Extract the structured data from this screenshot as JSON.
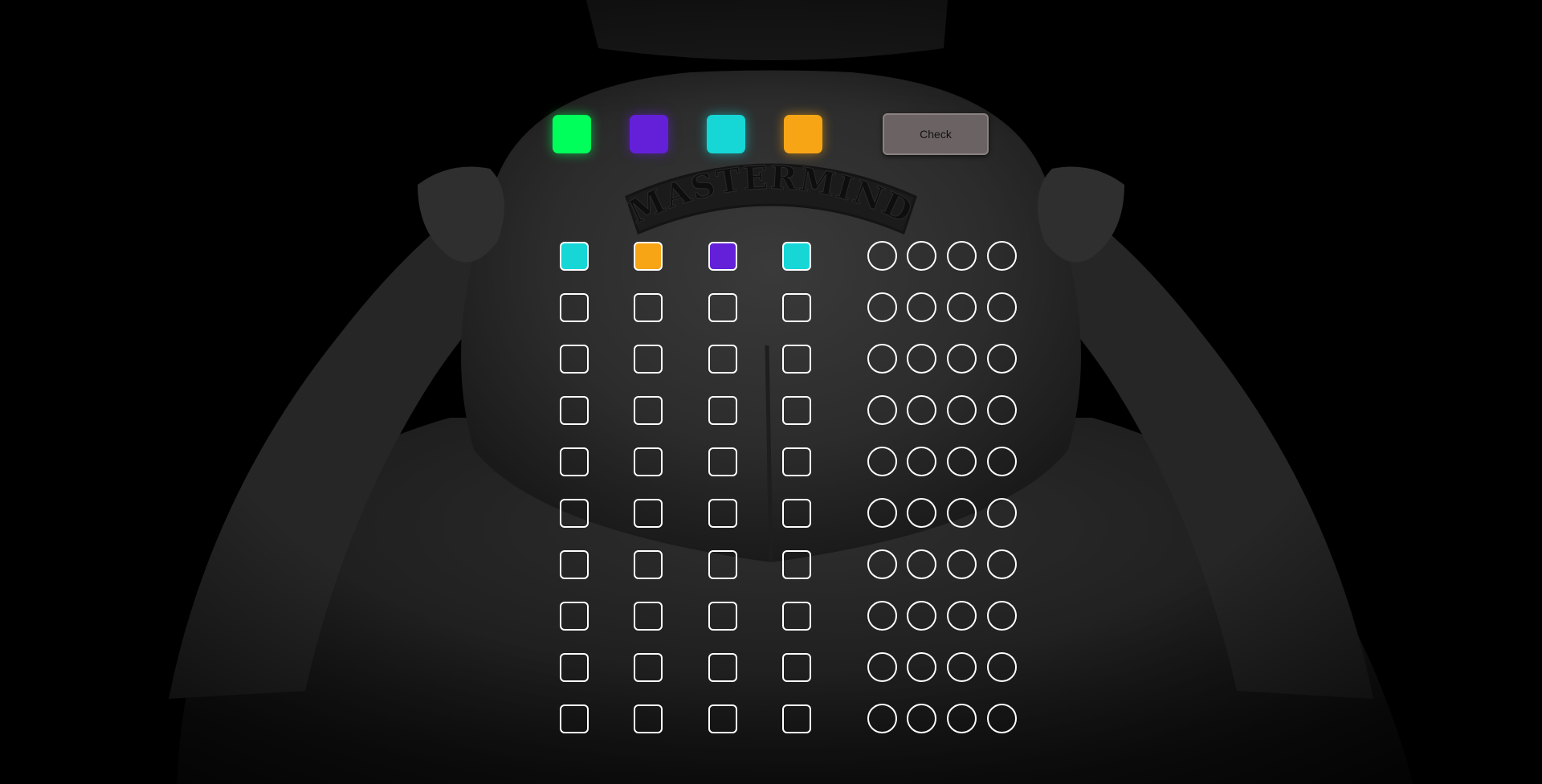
{
  "game": {
    "check_label": "Check",
    "logo_text": "MASTERMIND"
  },
  "palette": [
    {
      "name": "green",
      "color": "#00ff5a"
    },
    {
      "name": "purple",
      "color": "#6420d8"
    },
    {
      "name": "cyan",
      "color": "#16d6d6"
    },
    {
      "name": "orange",
      "color": "#f7a515"
    }
  ],
  "rows": [
    {
      "guess": [
        "#16d6d6",
        "#f7a515",
        "#6420d8",
        "#16d6d6"
      ],
      "pegs": [
        null,
        null,
        null,
        null
      ]
    },
    {
      "guess": [
        null,
        null,
        null,
        null
      ],
      "pegs": [
        null,
        null,
        null,
        null
      ]
    },
    {
      "guess": [
        null,
        null,
        null,
        null
      ],
      "pegs": [
        null,
        null,
        null,
        null
      ]
    },
    {
      "guess": [
        null,
        null,
        null,
        null
      ],
      "pegs": [
        null,
        null,
        null,
        null
      ]
    },
    {
      "guess": [
        null,
        null,
        null,
        null
      ],
      "pegs": [
        null,
        null,
        null,
        null
      ]
    },
    {
      "guess": [
        null,
        null,
        null,
        null
      ],
      "pegs": [
        null,
        null,
        null,
        null
      ]
    },
    {
      "guess": [
        null,
        null,
        null,
        null
      ],
      "pegs": [
        null,
        null,
        null,
        null
      ]
    },
    {
      "guess": [
        null,
        null,
        null,
        null
      ],
      "pegs": [
        null,
        null,
        null,
        null
      ]
    },
    {
      "guess": [
        null,
        null,
        null,
        null
      ],
      "pegs": [
        null,
        null,
        null,
        null
      ]
    },
    {
      "guess": [
        null,
        null,
        null,
        null
      ],
      "pegs": [
        null,
        null,
        null,
        null
      ]
    }
  ]
}
